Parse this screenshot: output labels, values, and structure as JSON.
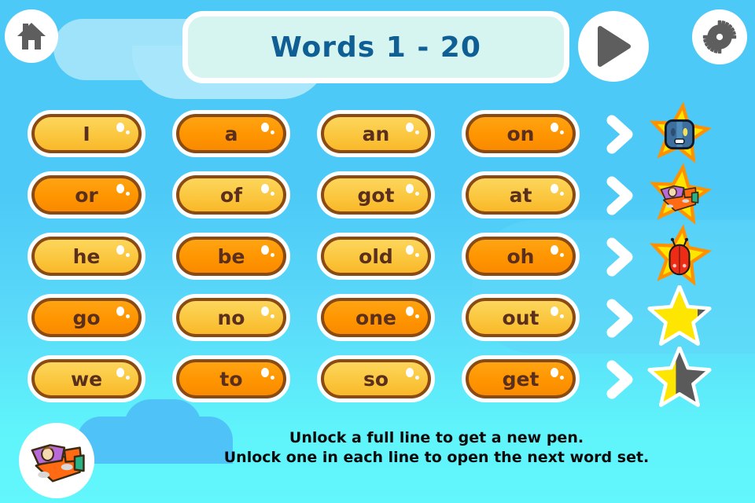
{
  "header": {
    "title": "Words  1 - 20",
    "home_icon": "home-icon",
    "play_icon": "play-icon",
    "gear_icon": "gear-icon"
  },
  "colors": {
    "background_top": "#4DC9F7",
    "background_bottom": "#5FF3FB",
    "title_text": "#105F94",
    "title_panel": "#D6F5F0",
    "word_light": "#FBC73F",
    "word_dark": "#FF9500",
    "word_text": "#5A2F1E",
    "word_border": "#8A4A14",
    "star_gold": "#FFE600",
    "star_orange": "#FF9100",
    "star_gray": "#5A5A5A"
  },
  "rows": [
    {
      "words": [
        {
          "label": "I",
          "state": "light"
        },
        {
          "label": "a",
          "state": "dark"
        },
        {
          "label": "an",
          "state": "light"
        },
        {
          "label": "on",
          "state": "dark"
        }
      ],
      "reward": {
        "type": "unlocked",
        "icon": "robot-icon",
        "fill_percent": 100
      }
    },
    {
      "words": [
        {
          "label": "or",
          "state": "dark"
        },
        {
          "label": "of",
          "state": "light"
        },
        {
          "label": "got",
          "state": "light"
        },
        {
          "label": "at",
          "state": "light"
        }
      ],
      "reward": {
        "type": "unlocked",
        "icon": "airplane-icon",
        "fill_percent": 100
      }
    },
    {
      "words": [
        {
          "label": "he",
          "state": "light"
        },
        {
          "label": "be",
          "state": "dark"
        },
        {
          "label": "old",
          "state": "light"
        },
        {
          "label": "oh",
          "state": "dark"
        }
      ],
      "reward": {
        "type": "unlocked",
        "icon": "ladybug-icon",
        "fill_percent": 100
      }
    },
    {
      "words": [
        {
          "label": "go",
          "state": "dark"
        },
        {
          "label": "no",
          "state": "light"
        },
        {
          "label": "one",
          "state": "dark"
        },
        {
          "label": "out",
          "state": "light"
        }
      ],
      "reward": {
        "type": "progress",
        "icon": "star-icon",
        "fill_percent": 75
      }
    },
    {
      "words": [
        {
          "label": "we",
          "state": "light"
        },
        {
          "label": "to",
          "state": "dark"
        },
        {
          "label": "so",
          "state": "light"
        },
        {
          "label": "get",
          "state": "dark"
        }
      ],
      "reward": {
        "type": "progress",
        "icon": "star-icon",
        "fill_percent": 45
      }
    }
  ],
  "footer": {
    "badge_icon": "airplane-badge-icon",
    "line1": "Unlock a full line to get a new pen.",
    "line2": "Unlock one in each line to open the next word set."
  }
}
